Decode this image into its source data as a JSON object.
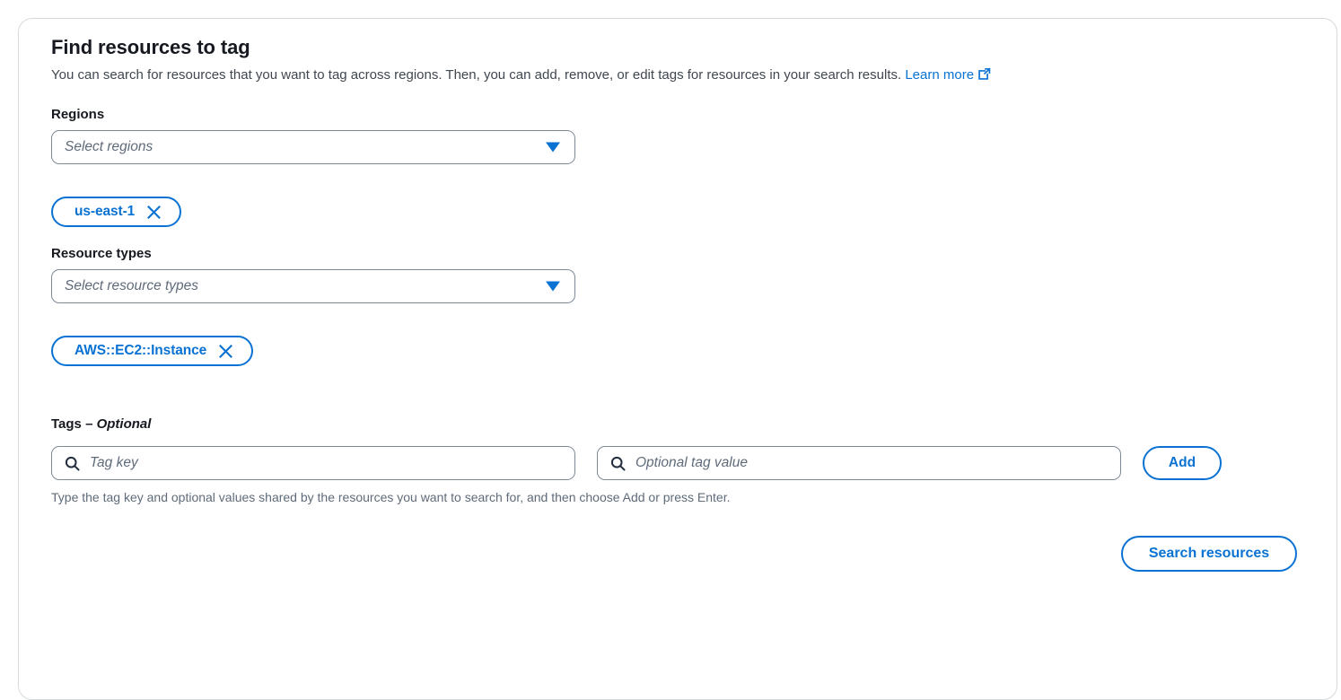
{
  "page": {
    "title": "Find resources to tag",
    "description_before_link": "You can search for resources that you want to tag across regions. Then, you can add, remove, or edit tags for resources in your search results.",
    "learn_more_label": "Learn more",
    "learn_more_icon": "external-link-icon"
  },
  "regions": {
    "label": "Regions",
    "select_placeholder": "Select regions",
    "chevron_icon": "chevron-down-icon",
    "tokens": [
      {
        "label": "us-east-1",
        "dismiss_icon": "close-icon"
      }
    ]
  },
  "resource_types": {
    "label": "Resource types",
    "select_placeholder": "Select resource types",
    "chevron_icon": "chevron-down-icon",
    "tokens": [
      {
        "label": "AWS::EC2::Instance",
        "dismiss_icon": "close-icon"
      }
    ]
  },
  "tags": {
    "label_main": "Tags – ",
    "label_optional": "Optional",
    "key_placeholder": "Tag key",
    "value_placeholder": "Optional tag value",
    "key_value": "",
    "value_value": "",
    "search_icon": "search-icon",
    "add_label": "Add",
    "helper_text": "Type the tag key and optional values shared by the resources you want to search for, and then choose Add or press Enter."
  },
  "footer": {
    "search_resources_label": "Search resources"
  },
  "colors": {
    "accent_blue": "#0972d3",
    "border_gray": "#7d8998",
    "card_border": "#d5dbdb",
    "text_dark": "#16191f",
    "text_muted": "#5f6b7a"
  }
}
